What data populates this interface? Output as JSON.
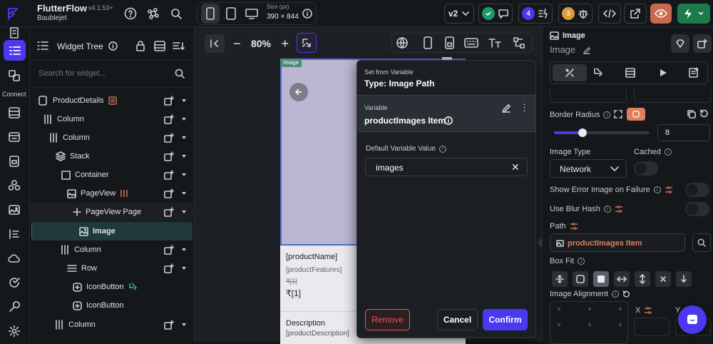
{
  "app": {
    "name": "FlutterFlow",
    "version": "v4.1.53+",
    "project": "Baublejet"
  },
  "topbar": {
    "size_label": "Size (px)",
    "size_value": "390 × 844",
    "version_select": "v2",
    "badge_errors": "4",
    "badge_warnings": "3"
  },
  "rail": {
    "connect_label": "Connect"
  },
  "tree": {
    "title": "Widget Tree",
    "search_placeholder": "Search for widget...",
    "nodes": [
      {
        "label": "ProductDetails"
      },
      {
        "label": "Column"
      },
      {
        "label": "Column"
      },
      {
        "label": "Stack"
      },
      {
        "label": "Container"
      },
      {
        "label": "PageView"
      },
      {
        "label": "PageView Page"
      },
      {
        "label": "Image"
      },
      {
        "label": "Column"
      },
      {
        "label": "Row"
      },
      {
        "label": "IconButton"
      },
      {
        "label": "IconButton"
      },
      {
        "label": "Column"
      }
    ]
  },
  "canvas": {
    "zoom": "80%",
    "image_tag": "Image",
    "product_name": "[productName]",
    "product_features": "[productFeatures]",
    "strike_price": "₹[1]",
    "price": "₹[1]",
    "description_title": "Description",
    "description_text": "[productDescription]"
  },
  "modal": {
    "header_label": "Set from Variable",
    "type_text": "Type: Image Path",
    "variable_label": "Variable",
    "variable_name": "productImages Item",
    "default_label": "Default Variable Value",
    "default_value": "images",
    "remove_label": "Remove",
    "cancel_label": "Cancel",
    "confirm_label": "Confirm"
  },
  "props": {
    "title": "Image",
    "name_value": "Image",
    "border_radius_label": "Border Radius",
    "border_radius_value": "8",
    "border_radius_fraction": 0.3,
    "image_type_label": "Image Type",
    "image_type_value": "Network",
    "cached_label": "Cached",
    "show_error_label": "Show Error Image on Failure",
    "blur_hash_label": "Use Blur Hash",
    "path_label": "Path",
    "path_value": "productImages Item",
    "box_fit_label": "Box Fit",
    "alignment_label": "Image Alignment",
    "x_label": "X",
    "y_label": "Y"
  },
  "colors": {
    "accent": "#4b39ef",
    "bg": "#14181b",
    "selected": "#1f3a39",
    "warning": "#e07f5b",
    "danger": "#ef5350",
    "green": "#1d7a4c"
  }
}
